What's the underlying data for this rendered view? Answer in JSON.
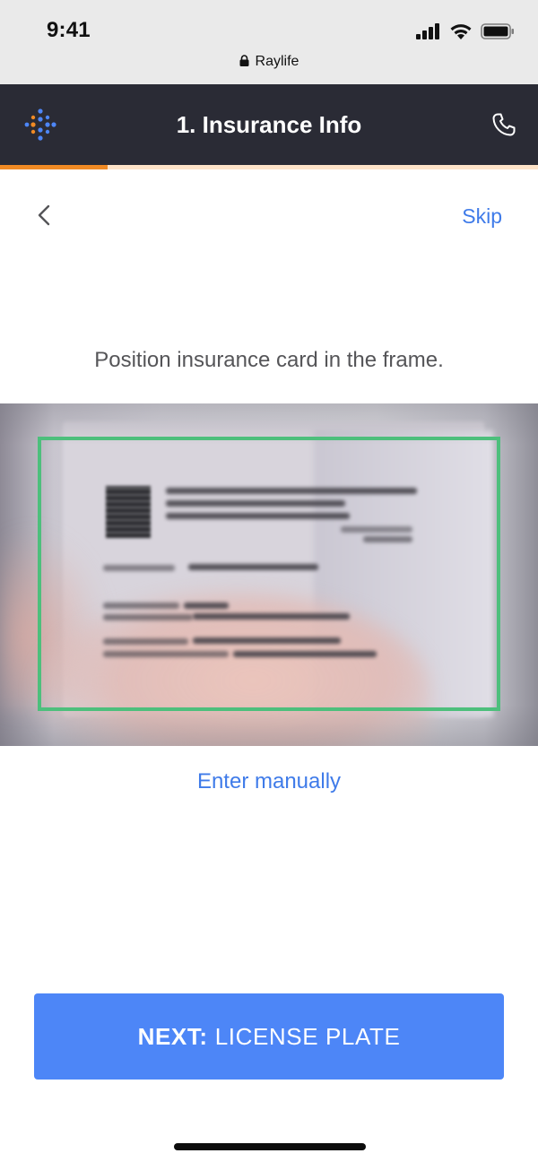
{
  "status_bar": {
    "time": "9:41",
    "url": "Raylife"
  },
  "header": {
    "title": "1. Insurance Info",
    "progress": 0.2
  },
  "nav": {
    "skip_label": "Skip"
  },
  "instruction": "Position insurance card in the frame.",
  "manual_link": "Enter manually",
  "next_button": {
    "prefix": "NEXT:",
    "label": "LICENSE PLATE"
  },
  "colors": {
    "accent": "#4d86f7",
    "link": "#3f7be9",
    "header_bg": "#2a2b35",
    "progress": "#f08a24",
    "frame": "#4dbf7c"
  }
}
